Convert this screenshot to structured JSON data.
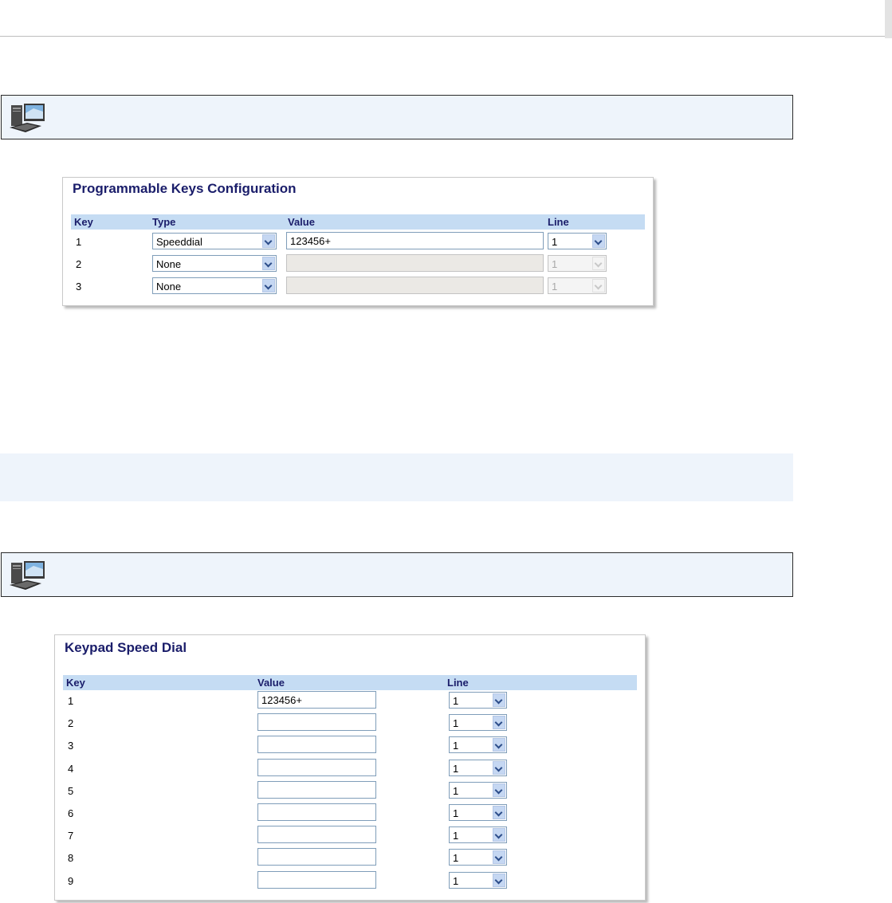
{
  "programmable_keys": {
    "title": "Programmable Keys Configuration",
    "headers": {
      "key": "Key",
      "type": "Type",
      "value": "Value",
      "line": "Line"
    },
    "rows": [
      {
        "key": "1",
        "type": "Speeddial",
        "value": "123456+",
        "line": "1",
        "disabled": false
      },
      {
        "key": "2",
        "type": "None",
        "value": "",
        "line": "1",
        "disabled": true
      },
      {
        "key": "3",
        "type": "None",
        "value": "",
        "line": "1",
        "disabled": true
      }
    ]
  },
  "keypad_speed_dial": {
    "title": "Keypad Speed Dial",
    "headers": {
      "key": "Key",
      "value": "Value",
      "line": "Line"
    },
    "rows": [
      {
        "key": "1",
        "value": "123456+",
        "line": "1"
      },
      {
        "key": "2",
        "value": "",
        "line": "1"
      },
      {
        "key": "3",
        "value": "",
        "line": "1"
      },
      {
        "key": "4",
        "value": "",
        "line": "1"
      },
      {
        "key": "5",
        "value": "",
        "line": "1"
      },
      {
        "key": "6",
        "value": "",
        "line": "1"
      },
      {
        "key": "7",
        "value": "",
        "line": "1"
      },
      {
        "key": "8",
        "value": "",
        "line": "1"
      },
      {
        "key": "9",
        "value": "",
        "line": "1"
      }
    ]
  },
  "icons": {
    "web_ui": "computer-monitor-icon",
    "dropdown": "chevron-down-icon"
  },
  "colors": {
    "heading": "#1a1d6a",
    "table_header_bg": "#c5dcf3",
    "note_bg": "#eef4fb"
  }
}
